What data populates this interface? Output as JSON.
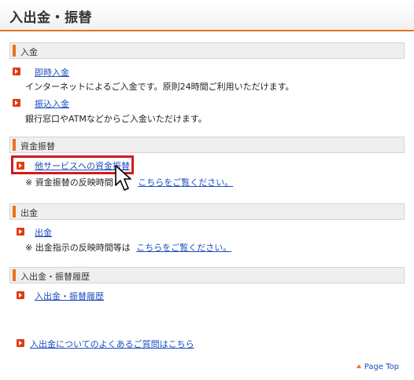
{
  "page": {
    "title": "入出金・振替"
  },
  "sections": {
    "deposit": {
      "heading": "入金",
      "instant": {
        "label": "即時入金",
        "desc": "インターネットによるご入金です。原則24時間ご利用いただけます。"
      },
      "transfer": {
        "label": "振込入金",
        "desc": "銀行窓口やATMなどからご入金いただけます。"
      }
    },
    "fund_transfer": {
      "heading": "資金振替",
      "other_service": {
        "label": "他サービスへの資金振替"
      },
      "note": {
        "prefix": "※ 資金振替の反映時間",
        "link": "こちらをご覧ください。"
      }
    },
    "withdrawal": {
      "heading": "出金",
      "withdraw": {
        "label": "出金"
      },
      "note": {
        "prefix": "※ 出金指示の反映時間等は",
        "link": "こちらをご覧ください。"
      }
    },
    "history": {
      "heading": "入出金・振替履歴",
      "item": {
        "label": "入出金・振替履歴"
      }
    }
  },
  "faq": {
    "label": "入出金についてのよくあるご質問はこちら"
  },
  "footer": {
    "page_top": "Page Top"
  },
  "colors": {
    "accent": "#e8731a",
    "link": "#1a4fbf",
    "arrow": "#e03c14",
    "highlight": "#d41a1a"
  }
}
